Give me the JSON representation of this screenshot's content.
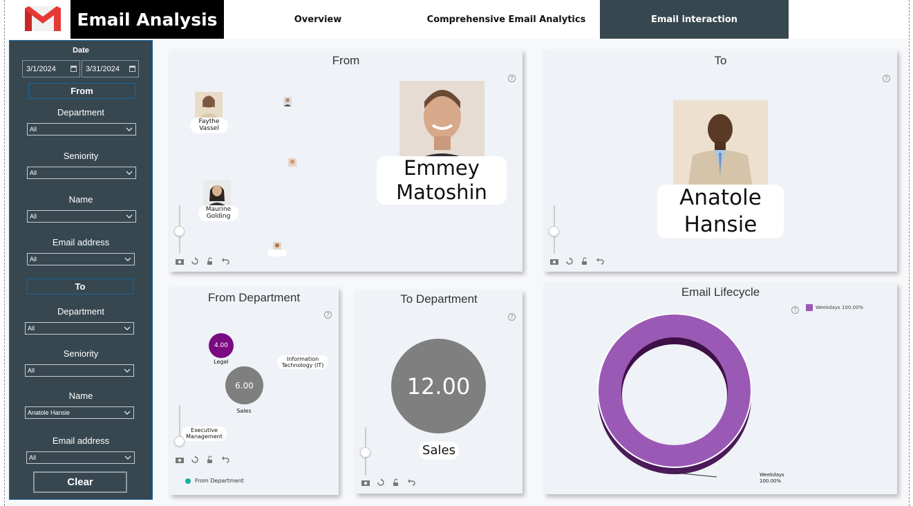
{
  "header": {
    "title": "Email Analysis",
    "nav": [
      "Overview",
      "Comprehensive Email Analytics",
      "Email interaction"
    ],
    "active_nav": "Email interaction",
    "brand_colors": {
      "red": "#e53935",
      "dark": "#37474f"
    }
  },
  "sidebar": {
    "date_label": "Date",
    "date_start": "3/1/2024",
    "date_end": "3/31/2024",
    "from_label": "From",
    "from": {
      "department_label": "Department",
      "department": "All",
      "seniority_label": "Seniority",
      "seniority": "All",
      "name_label": "Name",
      "name": "All",
      "email_label": "Email address",
      "email": "All"
    },
    "to_label": "To",
    "to": {
      "department_label": "Department",
      "department": "All",
      "seniority_label": "Seniority",
      "seniority": "All",
      "name_label": "Name",
      "name": "Anatole Hansie",
      "email_label": "Email address",
      "email": "All"
    },
    "clear_label": "Clear"
  },
  "from_panel": {
    "title": "From",
    "main_name_line1": "Emmey",
    "main_name_line2": "Matoshin",
    "people": [
      {
        "line1": "Faythe",
        "line2": "Vassel"
      },
      {
        "line1": "Maurine",
        "line2": "Golding"
      }
    ]
  },
  "to_panel": {
    "title": "To",
    "main_name_line1": "Anatole",
    "main_name_line2": "Hansie"
  },
  "from_department": {
    "title": "From Department",
    "nodes": [
      {
        "label": "Legel",
        "value": "4.00"
      },
      {
        "label": "Sales",
        "value": "6.00"
      }
    ],
    "it_line1": "Information",
    "it_line2": "Technology (IT)",
    "exec_line1": "Executive",
    "exec_line2": "Management",
    "legend": "From Department"
  },
  "to_department": {
    "title": "To Department",
    "value": "12.00",
    "label": "Sales"
  },
  "lifecycle": {
    "title": "Email Lifecycle",
    "legend": "Weekdays 100.00%",
    "callout_line1": "Weekdays",
    "callout_line2": "100.00%",
    "color": "#9b59b6"
  }
}
